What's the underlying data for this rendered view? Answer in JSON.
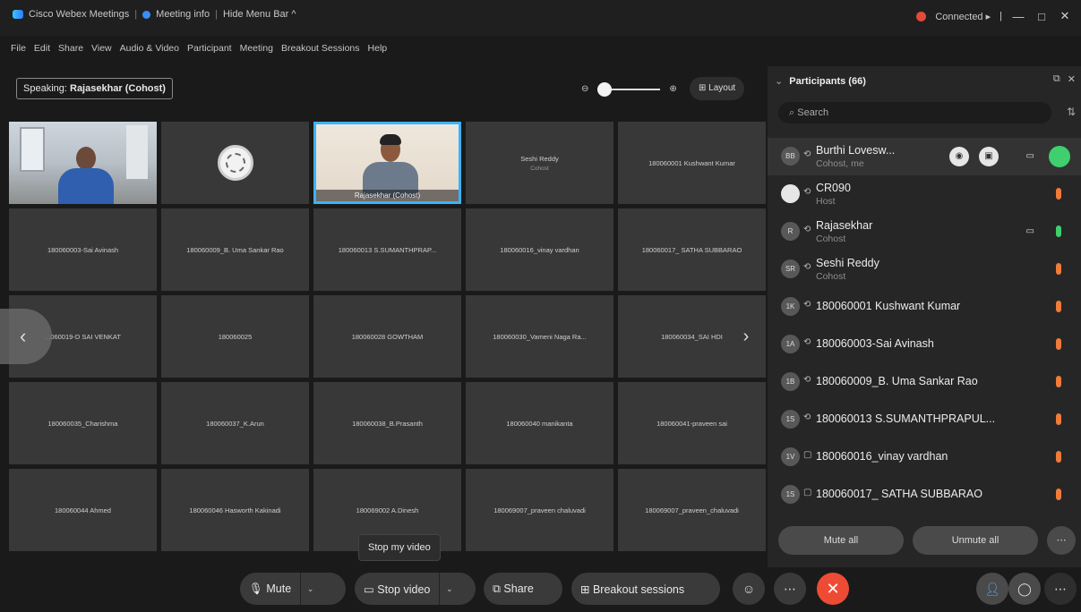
{
  "titlebar": {
    "app_title": "Cisco Webex Meetings",
    "meeting_info": "Meeting info",
    "hide_menu": "Hide Menu Bar ^",
    "connection": "Connected ▸",
    "minimize": "—",
    "maximize": "□",
    "close": "✕"
  },
  "menu": [
    "File",
    "Edit",
    "Share",
    "View",
    "Audio & Video",
    "Participant",
    "Meeting",
    "Breakout Sessions",
    "Help"
  ],
  "speaking": {
    "label": "Speaking:",
    "name": "Rajasekhar (Cohost)"
  },
  "layout_label": "Layout",
  "grid": [
    {
      "name": "",
      "type": "video1"
    },
    {
      "name": "",
      "type": "logo"
    },
    {
      "name": "Rajasekhar (Cohost)",
      "type": "video2"
    },
    {
      "name": "Seshi Reddy",
      "sub": "Cohost"
    },
    {
      "name": "180060001 Kushwant Kumar"
    },
    {
      "name": "180060003-Sai Avinash"
    },
    {
      "name": "180060009_B. Uma Sankar Rao"
    },
    {
      "name": "180060013 S.SUMANTHPRAP..."
    },
    {
      "name": "180060016_vinay vardhan"
    },
    {
      "name": "180060017_ SATHA SUBBARAO"
    },
    {
      "name": "...060019-D SAI VENKAT"
    },
    {
      "name": "180060025"
    },
    {
      "name": "180060028 GOWTHAM"
    },
    {
      "name": "180060030_Vameni Naga Ra..."
    },
    {
      "name": "180060034_SAI HDI"
    },
    {
      "name": "180060035_Charishma"
    },
    {
      "name": "180060037_K.Arun"
    },
    {
      "name": "180060038_B.Prasanth"
    },
    {
      "name": "180060040 manikanta"
    },
    {
      "name": "180060041-praveen sai"
    },
    {
      "name": "180060044 Ahmed"
    },
    {
      "name": "180060046 Hasworth Kakinadi"
    },
    {
      "name": "180069002 A.Dinesh"
    },
    {
      "name": "180069007_praveen chaluvadi"
    },
    {
      "name": "180069007_praveen_chaluvadi"
    }
  ],
  "tooltip": "Stop my video",
  "bottombar": {
    "mute": "Mute",
    "stop_video": "Stop video",
    "share": "Share",
    "breakout": "Breakout sessions"
  },
  "panel": {
    "title": "Participants (66)",
    "search_placeholder": "Search",
    "mute_all": "Mute all",
    "unmute_all": "Unmute all",
    "participants": [
      {
        "initials": "BB",
        "name": "Burthi Lovesw...",
        "role": "Cohost, me"
      },
      {
        "initials": "",
        "name": "CR090",
        "role": "Host"
      },
      {
        "initials": "R",
        "name": "Rajasekhar",
        "role": "Cohost"
      },
      {
        "initials": "SR",
        "name": "Seshi Reddy",
        "role": "Cohost"
      },
      {
        "initials": "1K",
        "name": "180060001 Kushwant Kumar",
        "role": ""
      },
      {
        "initials": "1A",
        "name": "180060003-Sai Avinash",
        "role": ""
      },
      {
        "initials": "1B",
        "name": "180060009_B. Uma Sankar Rao",
        "role": ""
      },
      {
        "initials": "1S",
        "name": "180060013 S.SUMANTHPRAPUL...",
        "role": ""
      },
      {
        "initials": "1V",
        "name": "180060016_vinay vardhan",
        "role": ""
      },
      {
        "initials": "1S",
        "name": "180060017_ SATHA SUBBARAO",
        "role": ""
      }
    ]
  }
}
